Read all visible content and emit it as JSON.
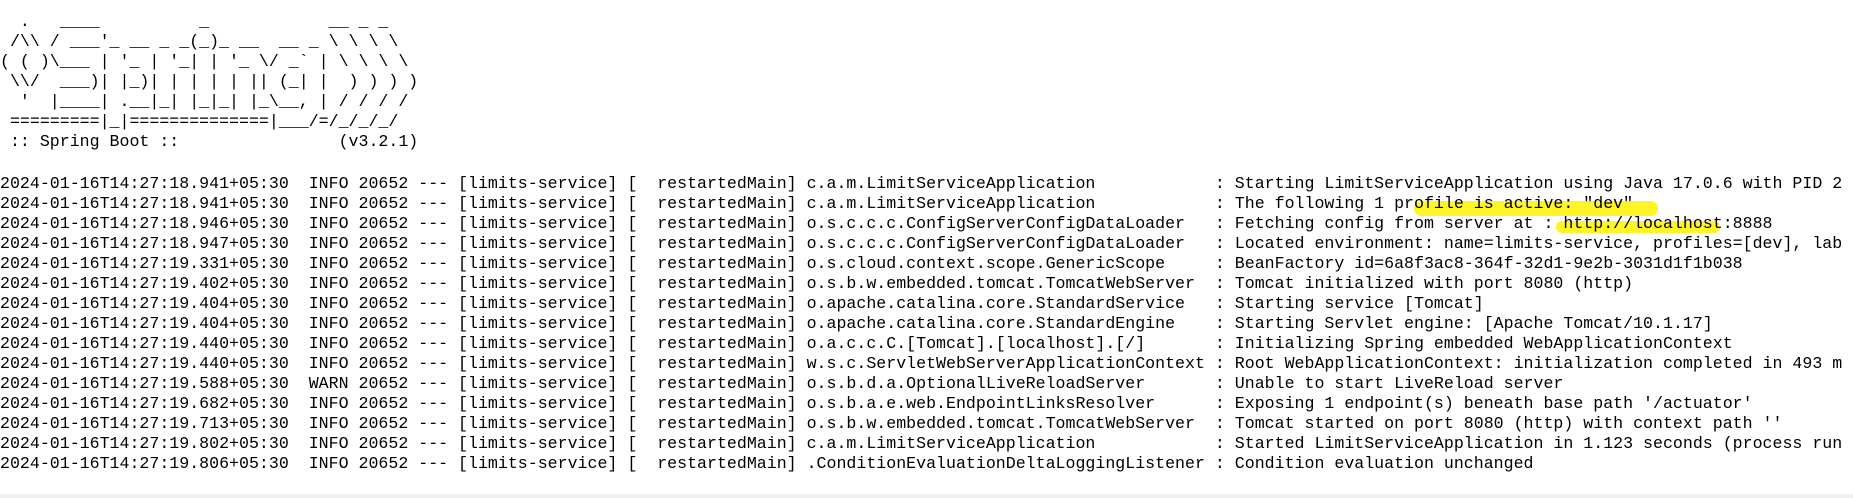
{
  "banner": [
    "  .   ____          _            __ _ _",
    " /\\\\ / ___'_ __ _ _(_)_ __  __ _ \\ \\ \\ \\",
    "( ( )\\___ | '_ | '_| | '_ \\/ _` | \\ \\ \\ \\",
    " \\\\/  ___)| |_)| | | | | || (_| |  ) ) ) )",
    "  '  |____| .__|_| |_|_| |_\\__, | / / / /",
    " =========|_|==============|___/=/_/_/_/",
    " :: Spring Boot ::                (v3.2.1)"
  ],
  "log_lines": [
    "2024-01-16T14:27:18.941+05:30  INFO 20652 --- [limits-service] [  restartedMain] c.a.m.LimitServiceApplication            : Starting LimitServiceApplication using Java 17.0.6 with PID 2",
    "2024-01-16T14:27:18.941+05:30  INFO 20652 --- [limits-service] [  restartedMain] c.a.m.LimitServiceApplication            : The following 1 profile is active: \"dev\"",
    "2024-01-16T14:27:18.946+05:30  INFO 20652 --- [limits-service] [  restartedMain] o.s.c.c.c.ConfigServerConfigDataLoader   : Fetching config from server at : http://localhost:8888",
    "2024-01-16T14:27:18.947+05:30  INFO 20652 --- [limits-service] [  restartedMain] o.s.c.c.c.ConfigServerConfigDataLoader   : Located environment: name=limits-service, profiles=[dev], lab",
    "2024-01-16T14:27:19.331+05:30  INFO 20652 --- [limits-service] [  restartedMain] o.s.cloud.context.scope.GenericScope     : BeanFactory id=6a8f3ac8-364f-32d1-9e2b-3031d1f1b038",
    "2024-01-16T14:27:19.402+05:30  INFO 20652 --- [limits-service] [  restartedMain] o.s.b.w.embedded.tomcat.TomcatWebServer  : Tomcat initialized with port 8080 (http)",
    "2024-01-16T14:27:19.404+05:30  INFO 20652 --- [limits-service] [  restartedMain] o.apache.catalina.core.StandardService   : Starting service [Tomcat]",
    "2024-01-16T14:27:19.404+05:30  INFO 20652 --- [limits-service] [  restartedMain] o.apache.catalina.core.StandardEngine    : Starting Servlet engine: [Apache Tomcat/10.1.17]",
    "2024-01-16T14:27:19.440+05:30  INFO 20652 --- [limits-service] [  restartedMain] o.a.c.c.C.[Tomcat].[localhost].[/]       : Initializing Spring embedded WebApplicationContext",
    "2024-01-16T14:27:19.440+05:30  INFO 20652 --- [limits-service] [  restartedMain] w.s.c.ServletWebServerApplicationContext : Root WebApplicationContext: initialization completed in 493 m",
    "2024-01-16T14:27:19.588+05:30  WARN 20652 --- [limits-service] [  restartedMain] o.s.b.d.a.OptionalLiveReloadServer       : Unable to start LiveReload server",
    "2024-01-16T14:27:19.682+05:30  INFO 20652 --- [limits-service] [  restartedMain] o.s.b.a.e.web.EndpointLinksResolver      : Exposing 1 endpoint(s) beneath base path '/actuator'",
    "2024-01-16T14:27:19.713+05:30  INFO 20652 --- [limits-service] [  restartedMain] o.s.b.w.embedded.tomcat.TomcatWebServer  : Tomcat started on port 8080 (http) with context path ''",
    "2024-01-16T14:27:19.802+05:30  INFO 20652 --- [limits-service] [  restartedMain] c.a.m.LimitServiceApplication            : Started LimitServiceApplication in 1.123 seconds (process run",
    "2024-01-16T14:27:19.806+05:30  INFO 20652 --- [limits-service] [  restartedMain] .ConditionEvaluationDeltaLoggingListener : Condition evaluation unchanged"
  ],
  "colors": {
    "background": "#ffffff",
    "text": "#000000",
    "highlight": "#fff200",
    "bottom_strip": "#f0f0f0"
  }
}
